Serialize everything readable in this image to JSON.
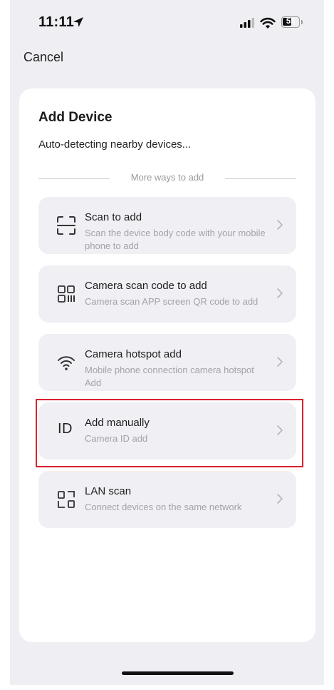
{
  "status_bar": {
    "time": "11:11",
    "battery": "55",
    "battery_level_percent": 55,
    "icons": [
      "location-arrow-icon",
      "signal-icon",
      "wifi-icon",
      "battery-icon"
    ]
  },
  "nav": {
    "cancel_label": "Cancel"
  },
  "card": {
    "title": "Add Device",
    "subtitle": "Auto-detecting nearby devices...",
    "divider_label": "More ways to add"
  },
  "options": [
    {
      "title": "Scan to add",
      "description": "Scan the device body code with your mobile phone to add",
      "icon": "scan-frame-icon"
    },
    {
      "title": "Camera scan code to add",
      "description": "Camera scan APP screen QR code to add",
      "icon": "qr-code-icon"
    },
    {
      "title": "Camera hotspot add",
      "description": "Mobile phone connection camera hotspot Add",
      "icon": "wifi-hotspot-icon"
    },
    {
      "title": "Add manually",
      "description": "Camera ID add",
      "icon": "id-icon",
      "icon_text": "ID"
    },
    {
      "title": "LAN scan",
      "description": "Connect devices on the same network",
      "icon": "lan-icon"
    }
  ],
  "colors": {
    "background": "#efeff3",
    "card": "#ffffff",
    "option_background": "#efeff4",
    "highlight": "#d9232e",
    "secondary_text": "#a3a3a8"
  }
}
